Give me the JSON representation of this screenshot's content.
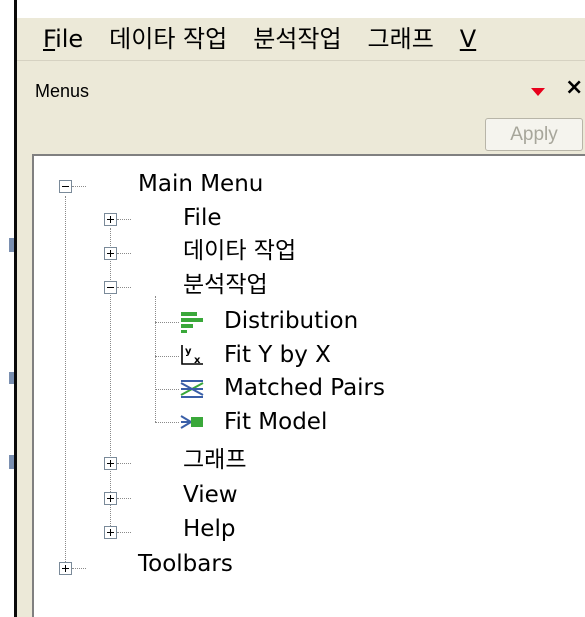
{
  "menubar": {
    "items": [
      {
        "underline": "F",
        "rest": "ile"
      },
      {
        "underline": "",
        "rest": "데이타 작업"
      },
      {
        "underline": "",
        "rest": "분석작업"
      },
      {
        "underline": "",
        "rest": "그래프"
      },
      {
        "underline": "V",
        "rest": ""
      }
    ]
  },
  "panel": {
    "title": "Menus",
    "close_symbol": "×",
    "apply_label": "Apply"
  },
  "tree": {
    "main_menu": "Main Menu",
    "file": "File",
    "data_work": "데이타 작업",
    "analysis": "분석작업",
    "distribution": "Distribution",
    "fit_y_by_x": "Fit Y by X",
    "fit_y_glyph_y": "y",
    "fit_y_glyph_x": "x",
    "matched_pairs": "Matched Pairs",
    "fit_model": "Fit Model",
    "graph": "그래프",
    "view": "View",
    "help": "Help",
    "toolbars": "Toolbars"
  },
  "colors": {
    "chrome_bg": "#ece9d8",
    "dropdown_red": "#e8001c",
    "icon_green": "#3aa83a",
    "icon_blue": "#3a5fa8"
  },
  "icons": [
    "dropdown-arrow-icon",
    "close-icon",
    "distribution-icon",
    "fit-y-by-x-icon",
    "matched-pairs-icon",
    "fit-model-icon"
  ]
}
